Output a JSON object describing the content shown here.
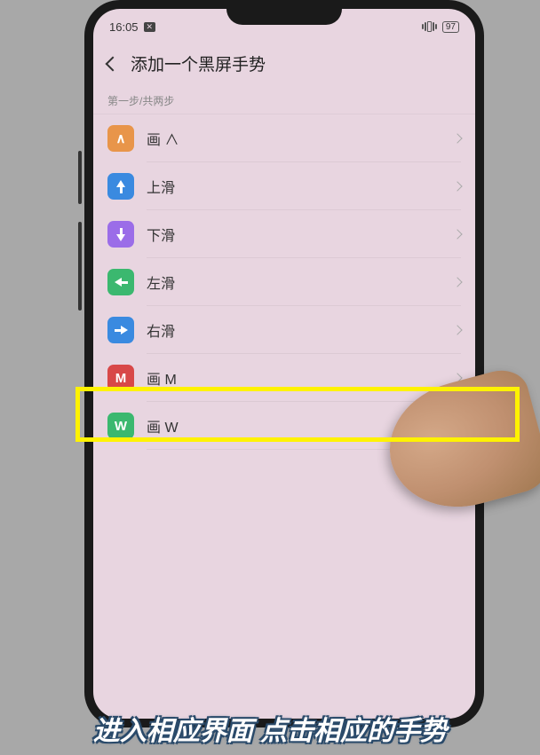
{
  "status": {
    "time": "16:05",
    "battery": "97"
  },
  "header": {
    "title": "添加一个黑屏手势"
  },
  "step": {
    "label": "第一步/共两步"
  },
  "items": [
    {
      "glyph": "∧",
      "label": "画 ∧",
      "bg": "#e8954a"
    },
    {
      "glyph": "up",
      "label": "上滑",
      "bg": "#3a8ae0"
    },
    {
      "glyph": "down",
      "label": "下滑",
      "bg": "#9b6de8"
    },
    {
      "glyph": "left",
      "label": "左滑",
      "bg": "#3bb86f"
    },
    {
      "glyph": "right",
      "label": "右滑",
      "bg": "#3a8ae0"
    },
    {
      "glyph": "M",
      "label": "画 M",
      "bg": "#d84848"
    },
    {
      "glyph": "W",
      "label": "画 W",
      "bg": "#3bb86f"
    }
  ],
  "caption": "进入相应界面 点击相应的手势"
}
